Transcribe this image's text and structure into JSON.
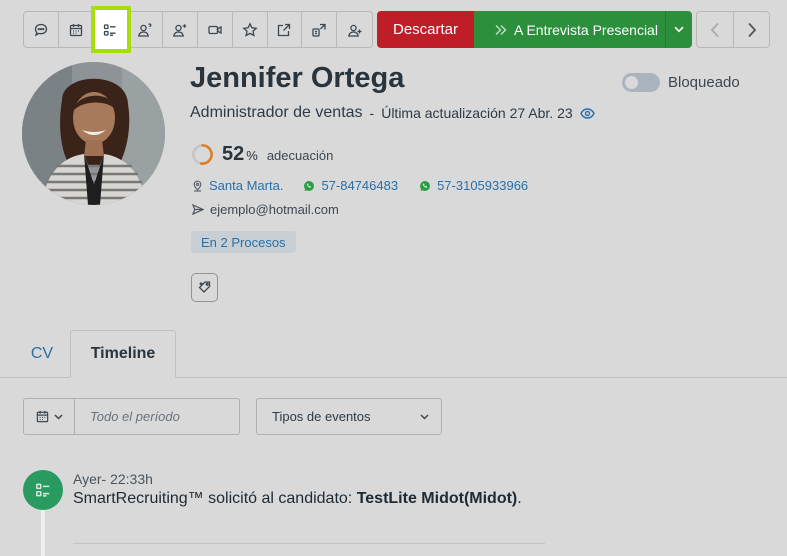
{
  "toolbar": {
    "icons": [
      "chat-icon",
      "calendar-icon",
      "checklist-icon",
      "user-question-icon",
      "user-add-icon",
      "video-icon",
      "star-icon",
      "external-edit-icon",
      "export-icon",
      "user-plus-icon"
    ],
    "discard_label": "Descartar",
    "stage_label": "A Entrevista Presencial"
  },
  "candidate": {
    "name": "Jennifer Ortega",
    "role": "Administrador de ventas",
    "separator": "-",
    "updated": "Última actualización 27 Abr. 23",
    "blocked_label": "Bloqueado",
    "blocked": false,
    "match_value": "52",
    "match_fraction": 0.52,
    "match_unit": "%",
    "match_label": "adecuación",
    "location": "Santa Marta.",
    "phone1": "57-84746483",
    "phone2": "57-3105933966",
    "email": "ejemplo@hotmail.com",
    "processes": "En 2 Procesos"
  },
  "tabs": {
    "cv": "CV",
    "timeline": "Timeline"
  },
  "filters": {
    "date_placeholder": "Todo el período",
    "event_types": "Tipos de eventos"
  },
  "timeline": {
    "time": "Ayer- 22:33h",
    "text_prefix": "SmartRecruiting™ solicitó al candidato: ",
    "test_name": "TestLite Midot(Midot)",
    "text_suffix": "."
  },
  "colors": {
    "discard": "#bf1e29",
    "stage": "#2c8f3c",
    "link": "#2a6fa8",
    "highlight": "#a7dd0a",
    "timeline_dot": "#2a9b60",
    "match_ring": "#e07b24"
  }
}
